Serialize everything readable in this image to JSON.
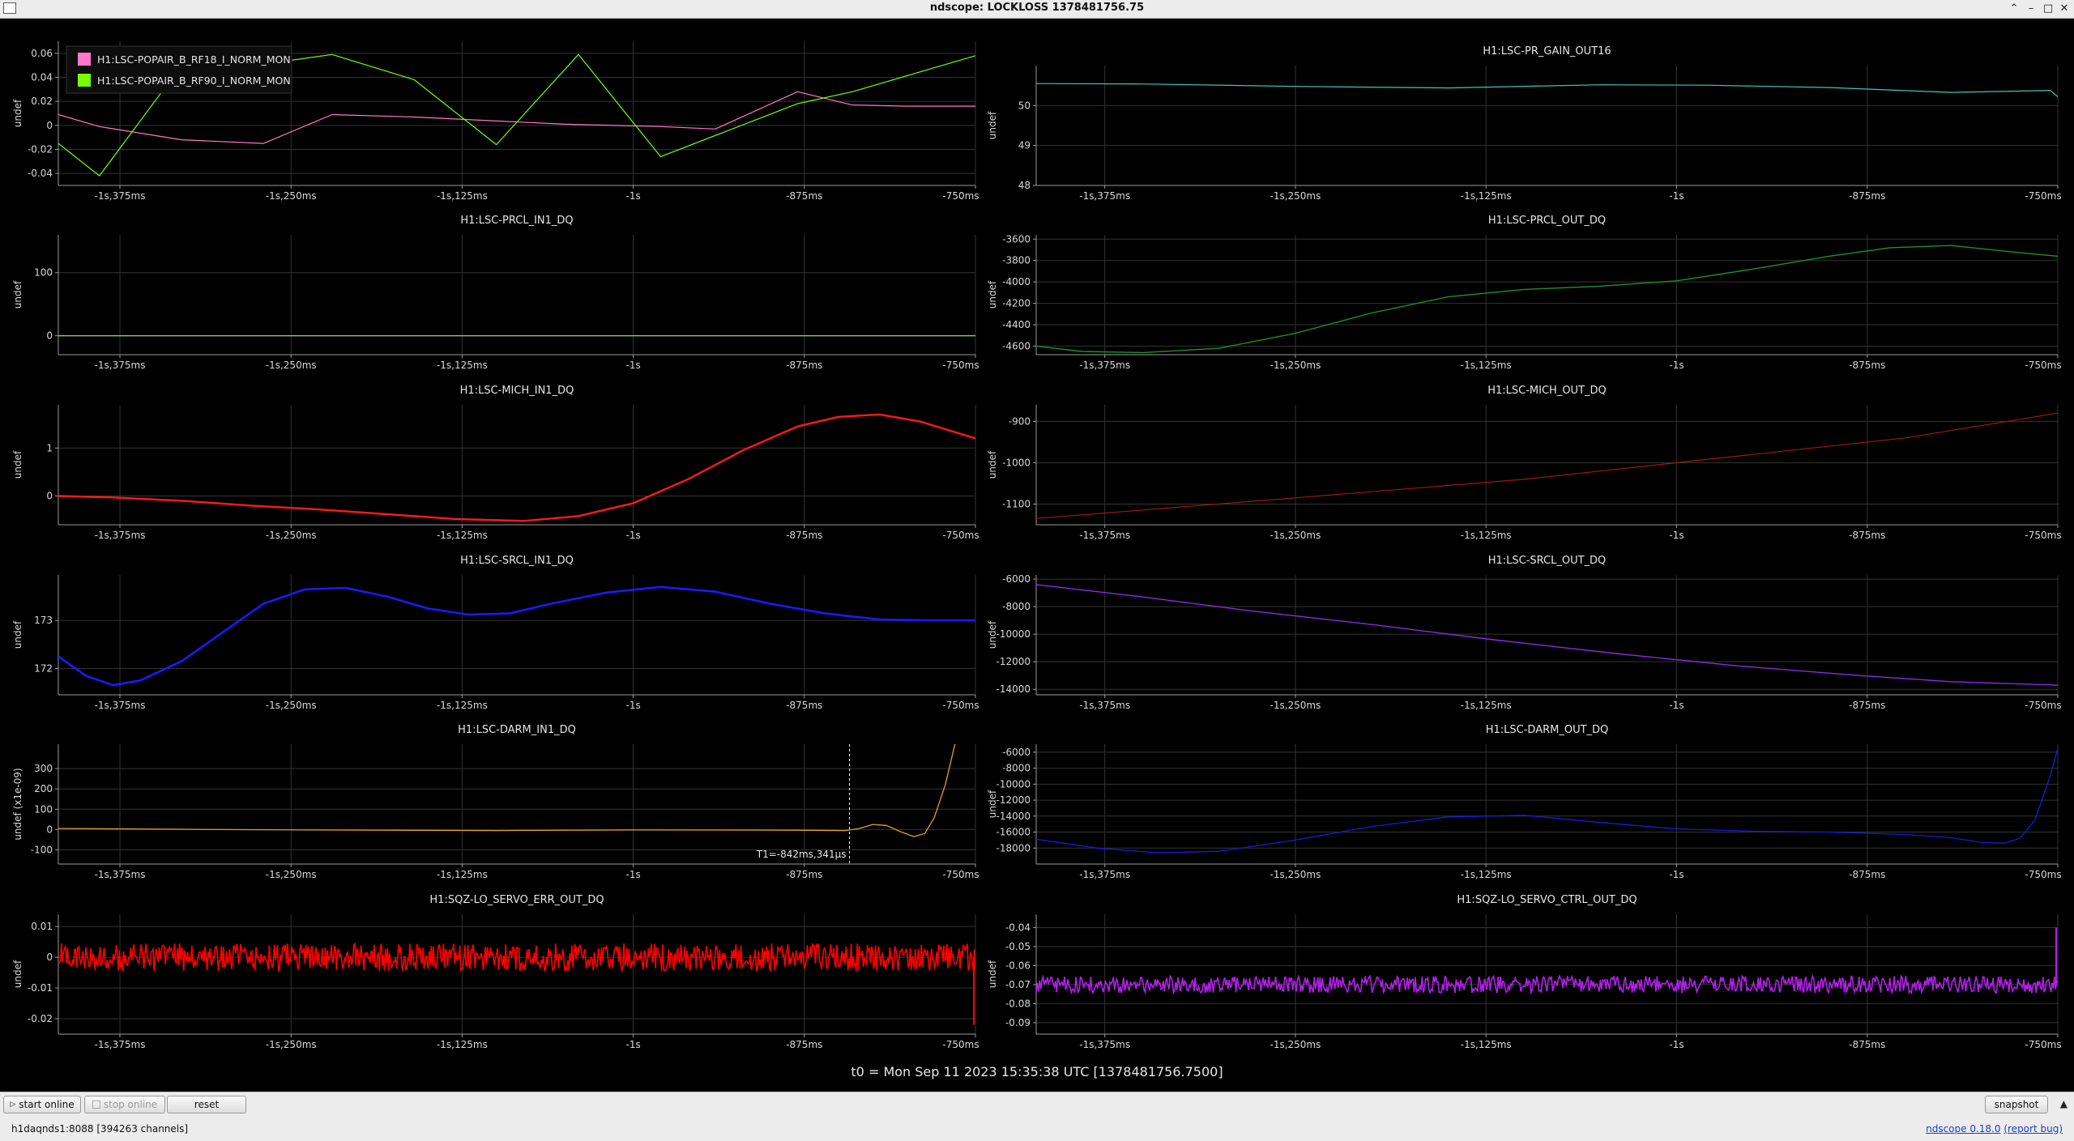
{
  "window": {
    "title": "ndscope: LOCKLOSS 1378481756.75",
    "buttons": {
      "minimize": "⌃",
      "restore": "–",
      "maximize": "□",
      "close": "✕"
    }
  },
  "footer": {
    "t0": "t0 = Mon Sep 11 2023 15:35:38 UTC [1378481756.7500]"
  },
  "controls": {
    "start_online": "start online",
    "stop_online": "stop online",
    "reset": "reset",
    "snapshot": "snapshot"
  },
  "status": {
    "server": "h1daqnds1:8088  [394263 channels]",
    "version": "ndscope 0.18.0",
    "report": "(report bug)"
  },
  "colors": {
    "background": "#000000",
    "grid": "#333333",
    "axis": "#9a9a9a",
    "cursor": "#ffffff"
  },
  "chart_data": [
    {
      "type": "line",
      "title": "",
      "ylabel": "undef",
      "ylim": [
        -0.05,
        0.07
      ],
      "yticks": [
        "0.06",
        "0.04",
        "0.02",
        "0",
        "-0.02",
        "-0.04"
      ],
      "yticks_values": [
        0.06,
        0.04,
        0.02,
        0,
        -0.02,
        -0.04
      ],
      "xlim": [
        -1.42,
        -0.75
      ],
      "xticks": [
        "-1s,375ms",
        "-1s,250ms",
        "-1s,125ms",
        "-1s",
        "-875ms",
        "-750ms"
      ],
      "xticks_values": [
        -1.375,
        -1.25,
        -1.125,
        -1.0,
        -0.875,
        -0.75
      ],
      "legend": "top-left",
      "series": [
        {
          "name": "H1:LSC-POPAIR_B_RF18_I_NORM_MON",
          "color": "#ff77c8",
          "width": 1.2,
          "x": [
            -1.42,
            -1.39,
            -1.33,
            -1.27,
            -1.22,
            -1.16,
            -1.05,
            -0.98,
            -0.94,
            -0.88,
            -0.84,
            -0.8,
            -0.75
          ],
          "y": [
            0.009,
            -0.001,
            -0.012,
            -0.015,
            0.009,
            0.007,
            0.001,
            -0.001,
            -0.003,
            0.028,
            0.017,
            0.016,
            0.016
          ]
        },
        {
          "name": "H1:LSC-POPAIR_B_RF90_I_NORM_MON",
          "color": "#77ff00",
          "width": 1.2,
          "x": [
            -1.42,
            -1.39,
            -1.33,
            -1.27,
            -1.22,
            -1.16,
            -1.1,
            -1.04,
            -0.98,
            -0.88,
            -0.84,
            -0.75
          ],
          "y": [
            -0.015,
            -0.042,
            0.05,
            0.051,
            0.059,
            0.038,
            -0.016,
            0.059,
            -0.026,
            0.018,
            0.028,
            0.058
          ]
        }
      ]
    },
    {
      "type": "line",
      "title": "H1:LSC-PR_GAIN_OUT16",
      "ylabel": "undef",
      "ylim": [
        48,
        51
      ],
      "yticks": [
        "50",
        "49",
        "48"
      ],
      "yticks_values": [
        50,
        49,
        48
      ],
      "xlim": [
        -1.42,
        -0.75
      ],
      "xticks": [
        "-1s,375ms",
        "-1s,250ms",
        "-1s,125ms",
        "-1s",
        "-875ms",
        "-750ms"
      ],
      "xticks_values": [
        -1.375,
        -1.25,
        -1.125,
        -1.0,
        -0.875,
        -0.75
      ],
      "series": [
        {
          "color": "#3cc6c0",
          "width": 1.2,
          "x": [
            -1.42,
            -1.35,
            -1.25,
            -1.15,
            -1.05,
            -0.98,
            -0.9,
            -0.82,
            -0.78,
            -0.755,
            -0.75
          ],
          "y": [
            50.55,
            50.54,
            50.48,
            50.44,
            50.52,
            50.51,
            50.45,
            50.33,
            50.36,
            50.38,
            50.22
          ]
        }
      ]
    },
    {
      "type": "line",
      "title": "H1:LSC-PRCL_IN1_DQ",
      "ylabel": "undef",
      "ylim": [
        -30,
        160
      ],
      "yticks": [
        "100",
        "0"
      ],
      "yticks_values": [
        100,
        0
      ],
      "xlim": [
        -1.42,
        -0.75
      ],
      "xticks": [
        "-1s,375ms",
        "-1s,250ms",
        "-1s,125ms",
        "-1s",
        "-875ms",
        "-750ms"
      ],
      "xticks_values": [
        -1.375,
        -1.25,
        -1.125,
        -1.0,
        -0.875,
        -0.75
      ],
      "series": [
        {
          "color": "#7de07d",
          "width": 1.2,
          "x": [
            -1.42,
            -0.75
          ],
          "y": [
            0,
            0
          ]
        }
      ]
    },
    {
      "type": "line",
      "title": "H1:LSC-PRCL_OUT_DQ",
      "ylabel": "undef",
      "ylim": [
        -4680,
        -3560
      ],
      "yticks": [
        "-3600",
        "-3800",
        "-4000",
        "-4200",
        "-4400",
        "-4600"
      ],
      "yticks_values": [
        -3600,
        -3800,
        -4000,
        -4200,
        -4400,
        -4600
      ],
      "xlim": [
        -1.42,
        -0.75
      ],
      "xticks": [
        "-1s,375ms",
        "-1s,250ms",
        "-1s,125ms",
        "-1s",
        "-875ms",
        "-750ms"
      ],
      "xticks_values": [
        -1.375,
        -1.25,
        -1.125,
        -1.0,
        -0.875,
        -0.75
      ],
      "series": [
        {
          "color": "#1f8f2a",
          "width": 1.4,
          "x": [
            -1.42,
            -1.39,
            -1.35,
            -1.3,
            -1.25,
            -1.2,
            -1.15,
            -1.1,
            -1.05,
            -1.0,
            -0.95,
            -0.9,
            -0.86,
            -0.82,
            -0.78,
            -0.75
          ],
          "y": [
            -4600,
            -4650,
            -4660,
            -4620,
            -4480,
            -4290,
            -4140,
            -4070,
            -4040,
            -3990,
            -3880,
            -3760,
            -3680,
            -3660,
            -3720,
            -3760
          ]
        }
      ]
    },
    {
      "type": "line",
      "title": "H1:LSC-MICH_IN1_DQ",
      "ylabel": "undef",
      "ylim": [
        -0.6,
        1.9
      ],
      "yticks": [
        "1",
        "0"
      ],
      "yticks_values": [
        1,
        0
      ],
      "xlim": [
        -1.42,
        -0.75
      ],
      "xticks": [
        "-1s,375ms",
        "-1s,250ms",
        "-1s,125ms",
        "-1s",
        "-875ms",
        "-750ms"
      ],
      "xticks_values": [
        -1.375,
        -1.25,
        -1.125,
        -1.0,
        -0.875,
        -0.75
      ],
      "series": [
        {
          "color": "#ff1a1a",
          "width": 2.4,
          "x": [
            -1.42,
            -1.38,
            -1.33,
            -1.28,
            -1.23,
            -1.18,
            -1.13,
            -1.08,
            -1.04,
            -1.0,
            -0.96,
            -0.92,
            -0.88,
            -0.85,
            -0.82,
            -0.79,
            -0.75
          ],
          "y": [
            0.0,
            -0.03,
            -0.1,
            -0.2,
            -0.28,
            -0.38,
            -0.48,
            -0.52,
            -0.42,
            -0.15,
            0.35,
            0.95,
            1.45,
            1.65,
            1.7,
            1.55,
            1.2
          ]
        }
      ]
    },
    {
      "type": "line",
      "title": "H1:LSC-MICH_OUT_DQ",
      "ylabel": "undef",
      "ylim": [
        -1150,
        -860
      ],
      "yticks": [
        "-900",
        "-1000",
        "-1100"
      ],
      "yticks_values": [
        -900,
        -1000,
        -1100
      ],
      "xlim": [
        -1.42,
        -0.75
      ],
      "xticks": [
        "-1s,375ms",
        "-1s,250ms",
        "-1s,125ms",
        "-1s",
        "-875ms",
        "-750ms"
      ],
      "xticks_values": [
        -1.375,
        -1.25,
        -1.125,
        -1.0,
        -0.875,
        -0.75
      ],
      "series": [
        {
          "color": "#9b1a1a",
          "width": 1.2,
          "x": [
            -1.42,
            -1.25,
            -1.1,
            -1.0,
            -0.85,
            -0.75
          ],
          "y": [
            -1135,
            -1085,
            -1040,
            -1000,
            -940,
            -880
          ]
        }
      ]
    },
    {
      "type": "line",
      "title": "H1:LSC-SRCL_IN1_DQ",
      "ylabel": "undef",
      "ylim": [
        171.45,
        173.95
      ],
      "yticks": [
        "173",
        "172"
      ],
      "yticks_values": [
        173,
        172
      ],
      "xlim": [
        -1.42,
        -0.75
      ],
      "xticks": [
        "-1s,375ms",
        "-1s,250ms",
        "-1s,125ms",
        "-1s",
        "-875ms",
        "-750ms"
      ],
      "xticks_values": [
        -1.375,
        -1.25,
        -1.125,
        -1.0,
        -0.875,
        -0.75
      ],
      "series": [
        {
          "color": "#1a1aff",
          "width": 2.6,
          "x": [
            -1.42,
            -1.4,
            -1.38,
            -1.36,
            -1.33,
            -1.3,
            -1.27,
            -1.24,
            -1.21,
            -1.18,
            -1.15,
            -1.12,
            -1.09,
            -1.06,
            -1.02,
            -0.98,
            -0.94,
            -0.9,
            -0.86,
            -0.82,
            -0.78,
            -0.75
          ],
          "y": [
            172.25,
            171.85,
            171.65,
            171.75,
            172.15,
            172.75,
            173.35,
            173.65,
            173.68,
            173.5,
            173.25,
            173.12,
            173.15,
            173.35,
            173.58,
            173.7,
            173.6,
            173.35,
            173.15,
            173.02,
            173.0,
            173.0
          ]
        }
      ]
    },
    {
      "type": "line",
      "title": "H1:LSC-SRCL_OUT_DQ",
      "ylabel": "undef",
      "ylim": [
        -14400,
        -5700
      ],
      "yticks": [
        "-6000",
        "-8000",
        "-10000",
        "-12000",
        "-14000"
      ],
      "yticks_values": [
        -6000,
        -8000,
        -10000,
        -12000,
        -14000
      ],
      "xlim": [
        -1.42,
        -0.75
      ],
      "xticks": [
        "-1s,375ms",
        "-1s,250ms",
        "-1s,125ms",
        "-1s",
        "-875ms",
        "-750ms"
      ],
      "xticks_values": [
        -1.375,
        -1.25,
        -1.125,
        -1.0,
        -0.875,
        -0.75
      ],
      "series": [
        {
          "color": "#8a2be2",
          "width": 1.4,
          "x": [
            -1.42,
            -1.35,
            -1.28,
            -1.2,
            -1.12,
            -1.04,
            -0.96,
            -0.88,
            -0.82,
            -0.75
          ],
          "y": [
            -6400,
            -7300,
            -8300,
            -9300,
            -10400,
            -11400,
            -12300,
            -13000,
            -13450,
            -13700
          ]
        }
      ]
    },
    {
      "type": "line",
      "title": "H1:LSC-DARM_IN1_DQ",
      "ylabel": "undef (x1e-09)",
      "ylim": [
        -170,
        420
      ],
      "yticks": [
        "300",
        "200",
        "100",
        "0",
        "-100"
      ],
      "yticks_values": [
        300,
        200,
        100,
        0,
        -100
      ],
      "xlim": [
        -1.42,
        -0.75
      ],
      "xticks": [
        "-1s,375ms",
        "-1s,250ms",
        "-1s,125ms",
        "-1s",
        "-875ms",
        "-750ms"
      ],
      "xticks_values": [
        -1.375,
        -1.25,
        -1.125,
        -1.0,
        -0.875,
        -0.75
      ],
      "annotations": [
        "T1=-842ms,341µs"
      ],
      "cursor_x": -0.842,
      "series": [
        {
          "color": "#e0a020",
          "width": 1.3,
          "x": [
            -1.42,
            -1.3,
            -1.2,
            -1.1,
            -1.0,
            -0.9,
            -0.845,
            -0.835,
            -0.825,
            -0.815,
            -0.805,
            -0.795,
            -0.787,
            -0.78,
            -0.772,
            -0.765
          ],
          "y": [
            5,
            0,
            -3,
            -5,
            -2,
            -3,
            -5,
            5,
            25,
            20,
            -10,
            -35,
            -20,
            60,
            220,
            420
          ]
        }
      ]
    },
    {
      "type": "line",
      "title": "H1:LSC-DARM_OUT_DQ",
      "ylabel": "undef",
      "ylim": [
        -20000,
        -5000
      ],
      "yticks": [
        "-6000",
        "-8000",
        "-10000",
        "-12000",
        "-14000",
        "-16000",
        "-18000"
      ],
      "yticks_values": [
        -6000,
        -8000,
        -10000,
        -12000,
        -14000,
        -16000,
        -18000
      ],
      "xlim": [
        -1.42,
        -0.75
      ],
      "xticks": [
        "-1s,375ms",
        "-1s,250ms",
        "-1s,125ms",
        "-1s",
        "-875ms",
        "-750ms"
      ],
      "xticks_values": [
        -1.375,
        -1.25,
        -1.125,
        -1.0,
        -0.875,
        -0.75
      ],
      "series": [
        {
          "color": "#1a1add",
          "width": 1.3,
          "x": [
            -1.42,
            -1.38,
            -1.34,
            -1.3,
            -1.25,
            -1.2,
            -1.15,
            -1.1,
            -1.05,
            -1.0,
            -0.95,
            -0.9,
            -0.85,
            -0.82,
            -0.8,
            -0.785,
            -0.775,
            -0.765,
            -0.755,
            -0.75
          ],
          "y": [
            -16900,
            -18000,
            -18600,
            -18400,
            -17000,
            -15300,
            -14100,
            -13900,
            -14800,
            -15600,
            -15900,
            -16000,
            -16300,
            -16700,
            -17300,
            -17400,
            -16800,
            -14500,
            -9000,
            -5500
          ]
        }
      ]
    },
    {
      "type": "line",
      "title": "H1:SQZ-LO_SERVO_ERR_OUT_DQ",
      "ylabel": "undef",
      "ylim": [
        -0.025,
        0.014
      ],
      "yticks": [
        "0.01",
        "0",
        "-0.01",
        "-0.02"
      ],
      "yticks_values": [
        0.01,
        0,
        -0.01,
        -0.02
      ],
      "xlim": [
        -1.42,
        -0.75
      ],
      "xticks": [
        "-1s,375ms",
        "-1s,250ms",
        "-1s,125ms",
        "-1s",
        "-875ms",
        "-750ms"
      ],
      "xticks_values": [
        -1.375,
        -1.25,
        -1.125,
        -1.0,
        -0.875,
        -0.75
      ],
      "noise": {
        "center": 0.0,
        "amplitude": 0.0045,
        "tail_end": -0.022
      },
      "series": [
        {
          "color": "#ff0000",
          "width": 1,
          "x": [
            -1.42,
            -0.75
          ],
          "y": [
            0,
            0
          ]
        }
      ]
    },
    {
      "type": "line",
      "title": "H1:SQZ-LO_SERVO_CTRL_OUT_DQ",
      "ylabel": "undef",
      "ylim": [
        -0.096,
        -0.033
      ],
      "yticks": [
        "-0.04",
        "-0.05",
        "-0.06",
        "-0.07",
        "-0.08",
        "-0.09"
      ],
      "yticks_values": [
        -0.04,
        -0.05,
        -0.06,
        -0.07,
        -0.08,
        -0.09
      ],
      "xlim": [
        -1.42,
        -0.75
      ],
      "xticks": [
        "-1s,375ms",
        "-1s,250ms",
        "-1s,125ms",
        "-1s",
        "-875ms",
        "-750ms"
      ],
      "xticks_values": [
        -1.375,
        -1.25,
        -1.125,
        -1.0,
        -0.875,
        -0.75
      ],
      "noise": {
        "center": -0.07,
        "amplitude": 0.0045,
        "tail_end": -0.04
      },
      "series": [
        {
          "color": "#b020e8",
          "width": 1,
          "x": [
            -1.42,
            -0.75
          ],
          "y": [
            -0.07,
            -0.07
          ]
        }
      ]
    }
  ]
}
